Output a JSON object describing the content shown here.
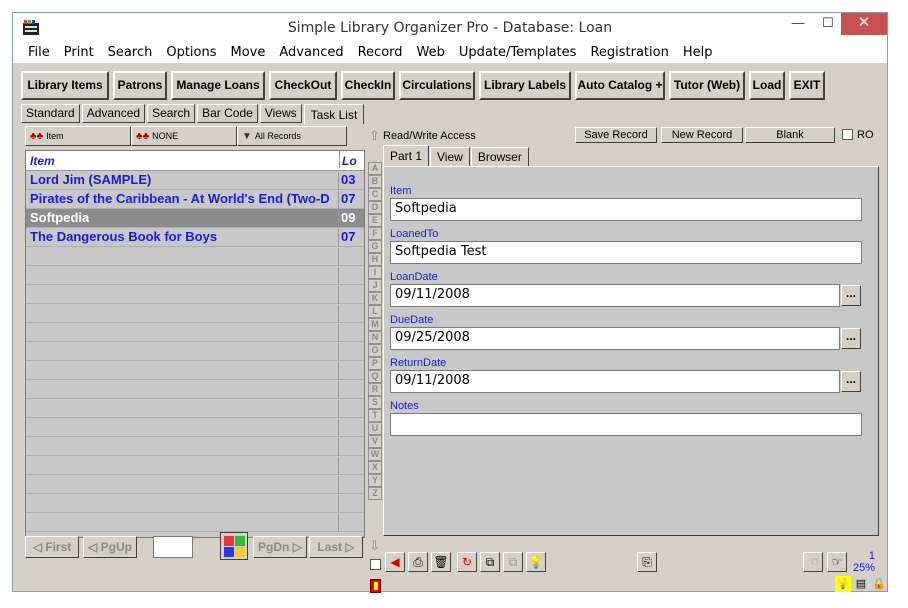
{
  "window": {
    "title": "Simple Library Organizer Pro - Database: Loan",
    "minimize": "—",
    "maximize": "☐",
    "close": "✕"
  },
  "menu": [
    "File",
    "Print",
    "Search",
    "Options",
    "Move",
    "Advanced",
    "Record",
    "Web",
    "Update/Templates",
    "Registration",
    "Help"
  ],
  "toolbar": [
    "Library Items",
    "Patrons",
    "Manage Loans",
    "CheckOut",
    "CheckIn",
    "Circulations",
    "Library Labels",
    "Auto Catalog +",
    "Tutor (Web)",
    "Load",
    "EXIT"
  ],
  "view_tabs": [
    "Standard",
    "Advanced",
    "Search",
    "Bar Code",
    "Views",
    "Task List"
  ],
  "active_view_tab": "Task List",
  "filters": {
    "field": "Item",
    "value": "NONE",
    "records": "All Records"
  },
  "grid": {
    "columns": [
      "Item",
      "Lo"
    ],
    "rows": [
      {
        "item": "Lord Jim  (SAMPLE)",
        "loan": "03"
      },
      {
        "item": "Pirates of the Caribbean - At World's End (Two-D",
        "loan": "07"
      },
      {
        "item": "Softpedia",
        "loan": "09",
        "selected": true
      },
      {
        "item": "The Dangerous Book for Boys",
        "loan": "07"
      }
    ],
    "empty_rows": 15
  },
  "nav": {
    "first": "First",
    "pgup": "PgUp",
    "page_value": "",
    "pgdn": "PgDn",
    "last": "Last"
  },
  "alphabet": [
    "A",
    "B",
    "C",
    "D",
    "E",
    "F",
    "G",
    "H",
    "I",
    "J",
    "K",
    "L",
    "M",
    "N",
    "O",
    "P",
    "Q",
    "R",
    "S",
    "T",
    "U",
    "V",
    "W",
    "X",
    "Y",
    "Z"
  ],
  "record_panel": {
    "access": "Read/Write Access",
    "save": "Save Record",
    "new": "New Record",
    "blank": "Blank",
    "ro": "RO"
  },
  "form_tabs": [
    "Part 1",
    "View",
    "Browser"
  ],
  "fields": [
    {
      "label": "Item",
      "value": "Softpedia",
      "date": false
    },
    {
      "label": "LoanedTo",
      "value": "Softpedia Test",
      "date": false
    },
    {
      "label": "LoanDate",
      "value": "09/11/2008",
      "date": true
    },
    {
      "label": "DueDate",
      "value": "09/25/2008",
      "date": true
    },
    {
      "label": "ReturnDate",
      "value": "09/11/2008",
      "date": true
    },
    {
      "label": "Notes",
      "value": "",
      "date": false
    }
  ],
  "dots_label": "...",
  "status": {
    "record_number": "1",
    "percent": "25%"
  },
  "colors": {
    "accent_text": "#1a1ad8",
    "selected_row": "#8c8c8c",
    "close_button": "#c75050"
  }
}
